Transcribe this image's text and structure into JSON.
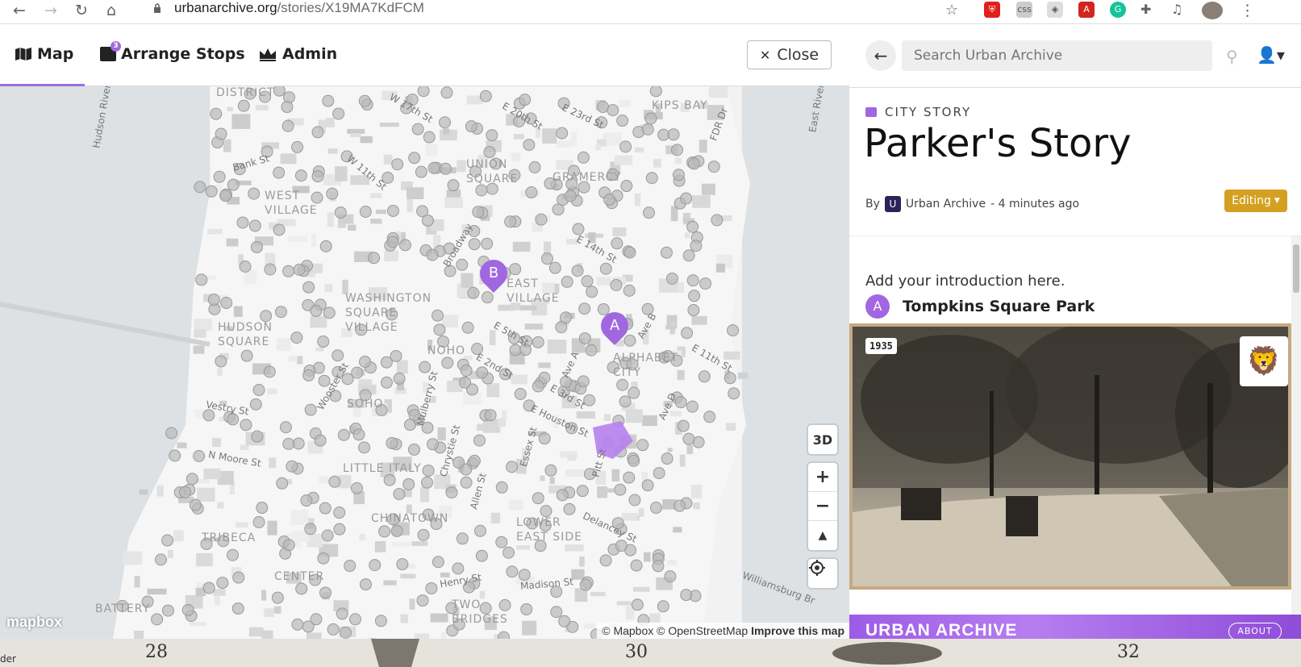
{
  "browser": {
    "url_host": "urbanarchive.org",
    "url_path": "/stories/X19MA7KdFCM"
  },
  "header": {
    "tabs": [
      {
        "label": "Map"
      },
      {
        "label": "Arrange Stops",
        "badge": "3"
      },
      {
        "label": "Admin"
      }
    ],
    "close_label": "Close"
  },
  "map": {
    "neighborhoods": [
      "DISTRICT",
      "KIPS BAY",
      "WEST VILLAGE",
      "UNION SQUARE",
      "GRAMERCY",
      "WASHINGTON SQUARE VILLAGE",
      "EAST VILLAGE",
      "HUDSON SQUARE",
      "ALPHABET CITY",
      "SOHO",
      "NOHO",
      "LITTLE ITALY",
      "CHINATOWN",
      "LOWER EAST SIDE",
      "TRIBECA",
      "CENTER",
      "TWO BRIDGES",
      "BATTERY"
    ],
    "streets": [
      "Hudson River",
      "E 23rd St",
      "E 20th St",
      "W 17th St",
      "Bank St",
      "E 14th St",
      "FDR Dr",
      "East River",
      "Ave B",
      "E 11th St",
      "E 5th St",
      "E 2nd St",
      "E 3rd St",
      "E Houston St",
      "Ave A",
      "Ave D",
      "Vestry St",
      "N Moore St",
      "Wooster St",
      "Mulberry St",
      "Chrystie St",
      "Allen St",
      "Essex St",
      "Pitt St",
      "Delancey St",
      "Henry St",
      "Madison St",
      "Williamsburg Br",
      "W 11th St",
      "Broadway"
    ],
    "markers": [
      {
        "letter": "B"
      },
      {
        "letter": "A"
      }
    ],
    "controls": {
      "three_d": "3D",
      "zoom_in": "+",
      "zoom_out": "−",
      "compass": "▲"
    },
    "attribution": {
      "mapbox": "© Mapbox",
      "osm": "© OpenStreetMap",
      "improve": "Improve this map"
    },
    "logo": "mapbox"
  },
  "panel": {
    "search_placeholder": "Search Urban Archive",
    "story_type": "CITY STORY",
    "title": "Parker's Story",
    "byline_prefix": "By",
    "author": "Urban Archive",
    "time": "- 4 minutes ago",
    "editing_label": "Editing",
    "intro": "Add your introduction here.",
    "stops": [
      {
        "letter": "A",
        "name": "Tompkins Square Park"
      }
    ],
    "photo_year": "1935",
    "footer_brand": "URBAN ARCHIVE",
    "about_label": "ABOUT"
  },
  "bottom_strip": {
    "left_text": "der",
    "numbers": [
      "28",
      "30",
      "32"
    ]
  },
  "colors": {
    "accent": "#a167e0",
    "editing": "#d5a021"
  }
}
